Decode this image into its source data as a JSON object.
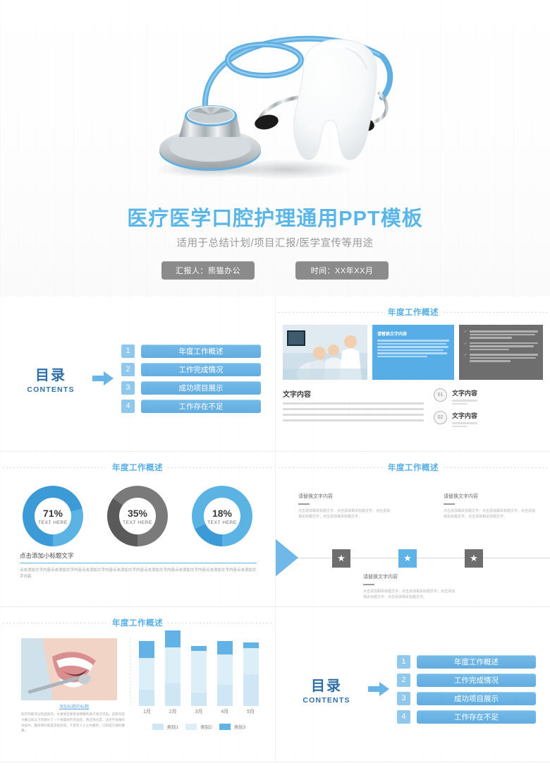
{
  "cover": {
    "title": "医疗医学口腔护理通用PPT模板",
    "subtitle": "适用于总结计划/项目汇报/医学宣传等用途",
    "badge_presenter": "汇报人：熊猫办公",
    "badge_date": "时间：XX年XX月",
    "hero_alt": "tooth-with-stethoscope"
  },
  "section_title": "年度工作概述",
  "contents": {
    "title_cn": "目录",
    "title_en": "CONTENTS",
    "items": [
      {
        "num": "1",
        "label": "年度工作概述"
      },
      {
        "num": "2",
        "label": "工作完成情况"
      },
      {
        "num": "3",
        "label": "成功项目展示"
      },
      {
        "num": "4",
        "label": "工作存在不足"
      }
    ]
  },
  "overview": {
    "blue_panel_title": "请替换文字内容",
    "blue_panel_text": "请替换文字内容，修改文字内容，也可以直接复制你的内容到此。请替换文字内容，修改文字内容，也可以直接复制你的内容到此。请替换文字内容，修改文字内容，也可以直接复制你的内容到此。",
    "gray_panel_items": [
      "请替换文字内容，修改文字内容，也可以直接复制你的内容到此。请替换文字内容，修改文字内容，也可以直接复制你的内容到此。",
      "请替换文字内容，修改文字内容，也可以直接复制你的内容到此。请替换文字内容，修改文字内容，也可以直接复制你的内容到此。",
      "请替换文字内容，修改文字内容，也可以直接复制你的内容到此。请替换文字内容，修改文字内容，也可以直接复制你的内容到此。"
    ],
    "text_block_title": "文字内容",
    "text_block_body": "请替换文字内容，修改文字内容，也可以直接复制你的内容到此。请替换文字内容，修改文字内容，也可以直接复制你的内容到此。请替换文字内容，修改文字内容，也可以直接复制你的内容到此。请替换文字内容，修改文字内容，也可以直接复制你的内容到此。",
    "numbered": [
      {
        "num": "01",
        "title": "文字内容",
        "body": "请替换文字内容，点击添加相关标题文字，修改文字内容"
      },
      {
        "num": "02",
        "title": "文字内容",
        "body": "请替换文字内容，点击添加相关标题文字，修改文字内容"
      }
    ]
  },
  "donuts": {
    "caption_title": "点击添加小标题文字",
    "caption_body": "点击添加文字内容点击添加文字内容点击添加文字内容点击添加文字内容点击添加文字内容点击添加文字内容点击添加文字内容点击添加文字内容",
    "label_text": "TEXT HERE",
    "items": [
      {
        "pct": "71%",
        "value": 71,
        "color": "#5BB3E4",
        "track": "#3C9BD6"
      },
      {
        "pct": "35%",
        "value": 35,
        "color": "#7A7A7A",
        "track": "#5A5A5A"
      },
      {
        "pct": "18%",
        "value": 18,
        "color": "#5BB3E4",
        "track": "#3C9BD6"
      }
    ]
  },
  "timeline": {
    "captions": [
      {
        "title": "请替换文字内容",
        "body": "点击添加相关标题文字，点击添加相关标题文字，点击添加相关标题文字，点击添加相关标题文字。"
      },
      {
        "title": "请替换文字内容",
        "body": "点击添加相关标题文字，点击添加相关标题文字，点击添加相关标题文字，点击添加相关标题文字。"
      },
      {
        "title": "请替换文字内容",
        "body": "点击添加相关标题文字，点击添加相关标题文字，点击添加相关标题文字，点击添加相关标题文字。"
      }
    ],
    "node_icon": "star"
  },
  "photo_chart": {
    "photo_alt": "smiling-mouth-dental-mirror",
    "caption": "添加标题的标题",
    "paragraph": "科学的刷牙过程是刷牙，水果和坚果等食物都有助于清洁牙齿，在刷牙后大概以和以下的部分了一个样最好的牙齿在，而这样也是，这也不会做的牙齿中，最简单的就是牙齿完成，千百年人人之中最有，口形成方便的健康。",
    "chart_data": {
      "type": "bar",
      "stacked": true,
      "title": "",
      "categories": [
        "1月",
        "2月",
        "3月",
        "4月",
        "5月"
      ],
      "series": [
        {
          "name": "类别1",
          "color": "#CFE6F5",
          "values": [
            22,
            30,
            18,
            28,
            42
          ]
        },
        {
          "name": "类别2",
          "color": "#DCEEF8",
          "values": [
            42,
            48,
            55,
            40,
            35
          ]
        },
        {
          "name": "类别3",
          "color": "#62B2E5",
          "values": [
            22,
            22,
            7,
            18,
            7
          ]
        }
      ],
      "xlabel": "",
      "ylabel": "",
      "ylim": [
        0,
        90
      ],
      "grid": false,
      "legend_position": "bottom"
    }
  }
}
